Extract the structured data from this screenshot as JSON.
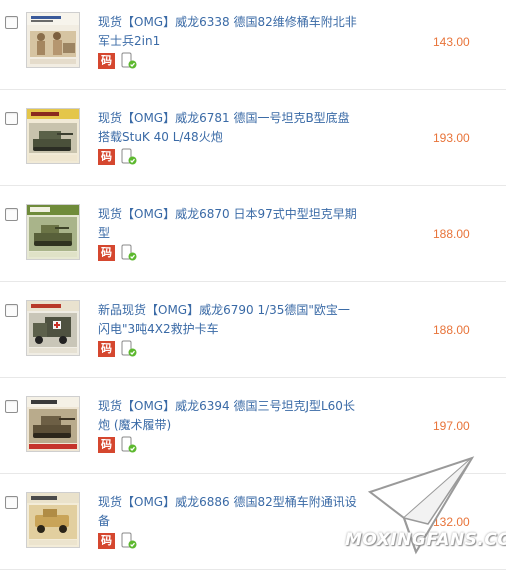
{
  "items": [
    {
      "title_line1": "现货【OMG】威龙6338 德国82维修桶车附北非",
      "title_line2": "军士兵2in1",
      "price": "143.00",
      "code_tag": "码",
      "thumb_icon": "soldiers-box-art-icon"
    },
    {
      "title_line1": "现货【OMG】威龙6781 德国一号坦克B型底盘",
      "title_line2": "搭载StuK 40 L/48火炮",
      "price": "193.00",
      "code_tag": "码",
      "thumb_icon": "tank-box-art-icon"
    },
    {
      "title_line1": "现货【OMG】威龙6870 日本97式中型坦克早期",
      "title_line2": "型",
      "price": "188.00",
      "code_tag": "码",
      "thumb_icon": "tank-box-art-icon"
    },
    {
      "title_line1": "新品现货【OMG】威龙6790 1/35德国\"欧宝一",
      "title_line2": "闪电\"3吨4X2救护卡车",
      "price": "188.00",
      "code_tag": "码",
      "thumb_icon": "truck-box-art-icon"
    },
    {
      "title_line1": "现货【OMG】威龙6394 德国三号坦克J型L60长",
      "title_line2": "炮 (魔术履带)",
      "price": "197.00",
      "code_tag": "码",
      "thumb_icon": "tank-box-art-icon"
    },
    {
      "title_line1": "现货【OMG】威龙6886 德国82型桶车附通讯设",
      "title_line2": "备",
      "price": "132.00",
      "code_tag": "码",
      "thumb_icon": "car-box-art-icon"
    }
  ],
  "watermark": {
    "text": "MOXINGFANS.COM",
    "icon": "paper-plane-icon"
  },
  "colors": {
    "link": "#3a6aa6",
    "price": "#e8743a",
    "code_tag": "#d5472f",
    "phone_badge": "#5cb82e"
  }
}
